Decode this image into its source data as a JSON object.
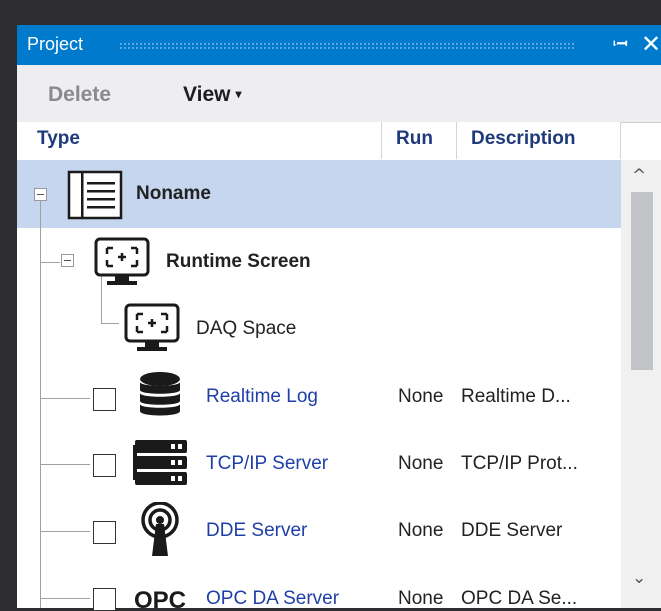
{
  "panel": {
    "title": "Project"
  },
  "toolbar": {
    "delete_label": "Delete",
    "view_label": "View"
  },
  "columns": {
    "type": "Type",
    "run": "Run",
    "description": "Description"
  },
  "tree": {
    "root": {
      "label": "Noname",
      "icon": "list-document-icon"
    },
    "runtime": {
      "label": "Runtime Screen",
      "icon": "monitor-screen-icon"
    },
    "daq": {
      "label": "DAQ Space",
      "icon": "monitor-screen-icon"
    },
    "items": [
      {
        "label": "Realtime Log",
        "run": "None",
        "description": "Realtime D...",
        "icon": "database-icon"
      },
      {
        "label": "TCP/IP Server",
        "run": "None",
        "description": "TCP/IP Prot...",
        "icon": "server-stack-icon"
      },
      {
        "label": "DDE Server",
        "run": "None",
        "description": "DDE Server",
        "icon": "broadcast-tower-icon"
      },
      {
        "label": "OPC DA Server",
        "run": "None",
        "description": "OPC DA Se...",
        "icon": "opc-logo-icon"
      }
    ]
  },
  "colors": {
    "title_bar": "#007acc",
    "selection": "#c6d6ee",
    "link_text": "#1f3fa8"
  }
}
